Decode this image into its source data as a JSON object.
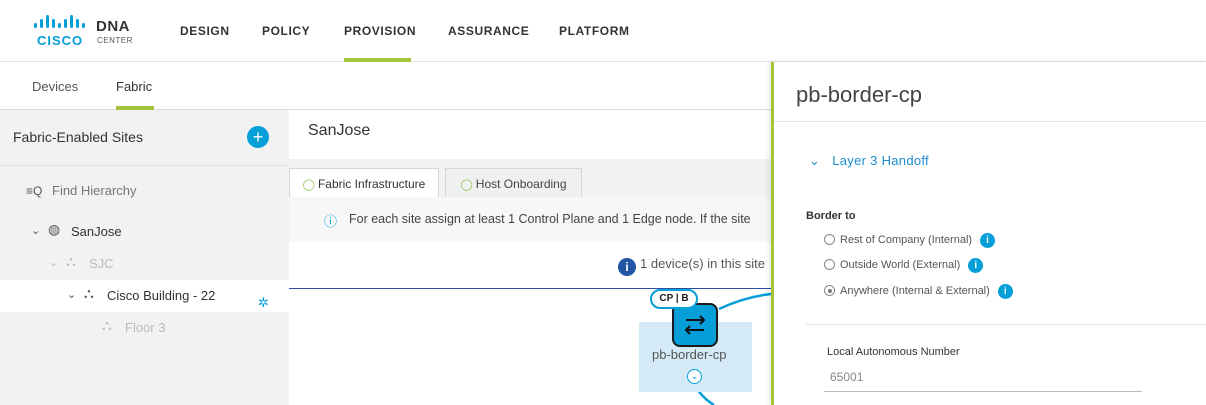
{
  "header": {
    "logo_brand": "CISCO",
    "logo_product": "DNA",
    "logo_sub": "CENTER",
    "nav": [
      "DESIGN",
      "POLICY",
      "PROVISION",
      "ASSURANCE",
      "PLATFORM"
    ],
    "active_nav": "PROVISION"
  },
  "subtabs": {
    "devices": "Devices",
    "fabric": "Fabric",
    "active": "Fabric"
  },
  "sidebar": {
    "title": "Fabric-Enabled Sites",
    "find_placeholder": "Find Hierarchy",
    "tree": [
      {
        "label": "SanJose"
      },
      {
        "label": "SJC"
      },
      {
        "label": "Cisco Building - 22"
      },
      {
        "label": "Floor 3"
      }
    ]
  },
  "main": {
    "site_title": "SanJose",
    "tabs": [
      {
        "label": "Fabric Infrastructure"
      },
      {
        "label": "Host Onboarding"
      }
    ],
    "info_text": "For each site assign at least 1 Control Plane and 1 Edge node. If the site",
    "device_count_text": "1 device(s) in this site",
    "node": {
      "role_tag": "CP | B",
      "name": "pb-border-cp"
    }
  },
  "panel": {
    "title": "pb-border-cp",
    "section": "Layer 3 Handoff",
    "border_to_label": "Border to",
    "options": [
      {
        "label": "Rest of Company (Internal)",
        "checked": false
      },
      {
        "label": "Outside World (External)",
        "checked": false
      },
      {
        "label": "Anywhere (Internal & External)",
        "checked": true
      }
    ],
    "local_as_label": "Local Autonomous Number",
    "local_as_value": "65001"
  },
  "colors": {
    "accent_green": "#a6c439",
    "cisco_blue": "#049fd9",
    "info_dark_blue": "#2156a5"
  }
}
